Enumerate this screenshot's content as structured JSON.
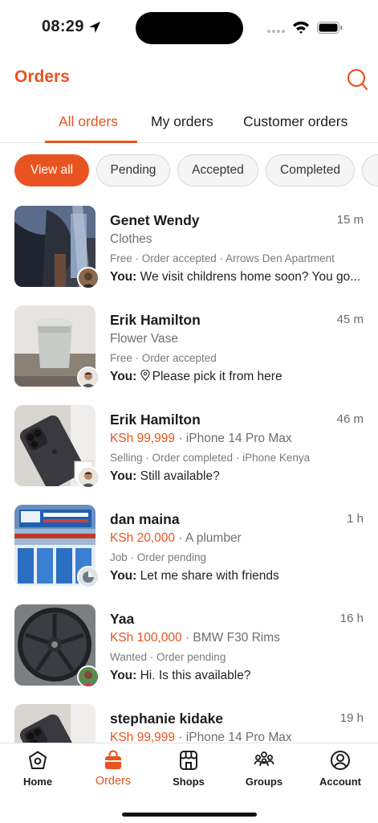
{
  "status_bar": {
    "time": "08:29"
  },
  "header": {
    "title": "Orders"
  },
  "tabs": [
    {
      "label": "All orders",
      "active": true
    },
    {
      "label": "My orders",
      "active": false
    },
    {
      "label": "Customer orders",
      "active": false
    }
  ],
  "filters": [
    {
      "label": "View all",
      "active": true
    },
    {
      "label": "Pending",
      "active": false
    },
    {
      "label": "Accepted",
      "active": false
    },
    {
      "label": "Completed",
      "active": false
    }
  ],
  "orders": [
    {
      "name": "Genet Wendy",
      "time": "15 m",
      "price": "",
      "title": "Clothes",
      "meta": "Free · Order accepted · Arrows Den Apartment",
      "sender": "You:",
      "message": "We visit childrens home soon? You go..."
    },
    {
      "name": "Erik Hamilton",
      "time": "45 m",
      "price": "",
      "title": "Flower Vase",
      "meta": "Free · Order accepted",
      "sender": "You:",
      "message": "Please pick it from here"
    },
    {
      "name": "Erik Hamilton",
      "time": "46 m",
      "price": "KSh 99,999",
      "title": " · iPhone 14 Pro Max",
      "meta": "Selling · Order completed · iPhone Kenya",
      "sender": "You:",
      "message": "Still available?"
    },
    {
      "name": "dan maina",
      "time": "1 h",
      "price": "KSh 20,000",
      "title": " · A plumber",
      "meta": "Job · Order pending",
      "sender": "You:",
      "message": "Let me share with friends"
    },
    {
      "name": "Yaa",
      "time": "16 h",
      "price": "KSh 100,000",
      "title": " · BMW F30 Rims",
      "meta": "Wanted · Order pending",
      "sender": "You:",
      "message": "Hi. Is this available?"
    },
    {
      "name": "stephanie kidake",
      "time": "19 h",
      "price": "KSh 99,999",
      "title": " · iPhone 14 Pro Max",
      "meta": "",
      "sender": "",
      "message": ""
    }
  ],
  "bottom_nav": [
    {
      "label": "Home",
      "icon": "home-icon"
    },
    {
      "label": "Orders",
      "icon": "orders-bag-icon",
      "active": true
    },
    {
      "label": "Shops",
      "icon": "shop-icon"
    },
    {
      "label": "Groups",
      "icon": "groups-icon"
    },
    {
      "label": "Account",
      "icon": "account-icon"
    }
  ],
  "colors": {
    "accent": "#e8531f",
    "text": "#1c1c1c",
    "muted": "#6e6e6e"
  }
}
